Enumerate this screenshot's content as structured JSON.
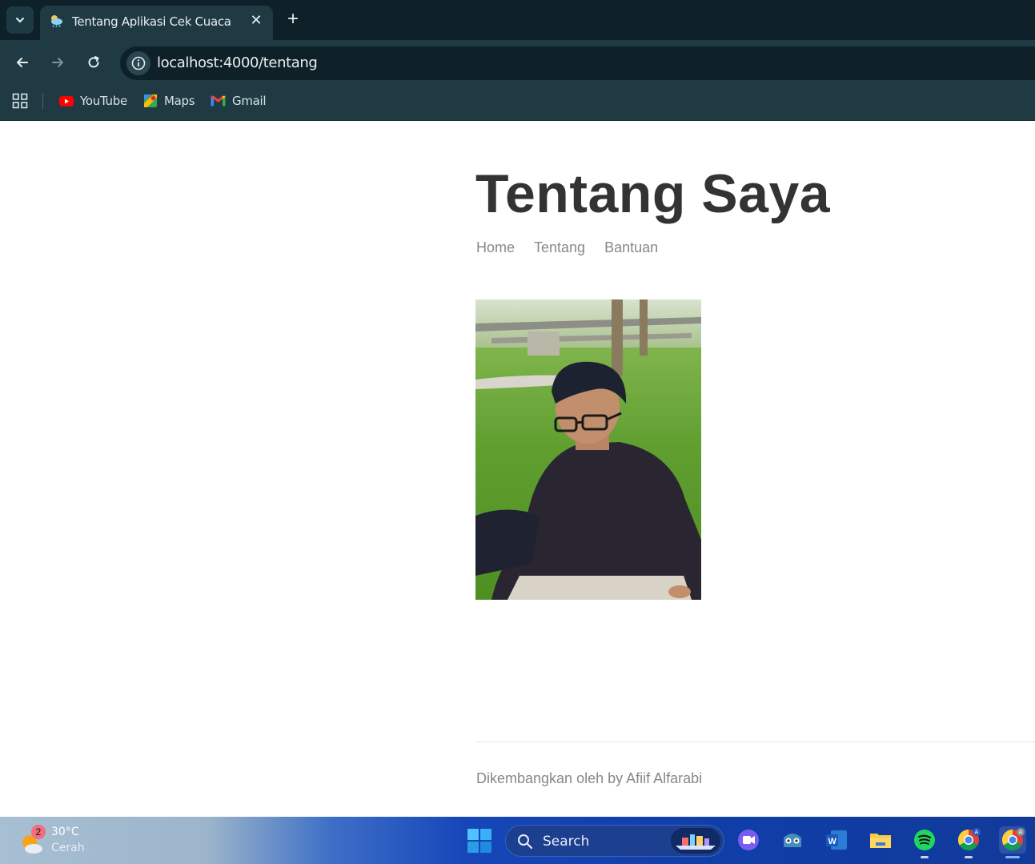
{
  "browser": {
    "tab": {
      "title": "Tentang Aplikasi Cek Cuaca",
      "favicon": "weather-icon"
    },
    "address_bar": {
      "url": "localhost:4000/tentang"
    },
    "bookmarks": [
      {
        "label": "YouTube",
        "icon": "youtube-icon"
      },
      {
        "label": "Maps",
        "icon": "maps-icon"
      },
      {
        "label": "Gmail",
        "icon": "gmail-icon"
      }
    ]
  },
  "page": {
    "title": "Tentang Saya",
    "nav": [
      "Home",
      "Tentang",
      "Bantuan"
    ],
    "photo": {
      "icon": "profile-photo"
    },
    "footer": "Dikembangkan oleh by Afiif Alfarabi"
  },
  "taskbar": {
    "weather": {
      "badge": "2",
      "temperature": "30°C",
      "condition": "Cerah"
    },
    "search_label": "Search",
    "apps": [
      "windows-start-icon",
      "meet-icon",
      "godot-icon",
      "word-icon",
      "file-explorer-icon",
      "spotify-icon",
      "chrome-icon",
      "chrome-icon"
    ]
  },
  "colors": {
    "chrome_dark": "#0f2128",
    "chrome_toolbar": "#1f3a43",
    "title_text": "#333333",
    "muted_text": "#888888"
  }
}
